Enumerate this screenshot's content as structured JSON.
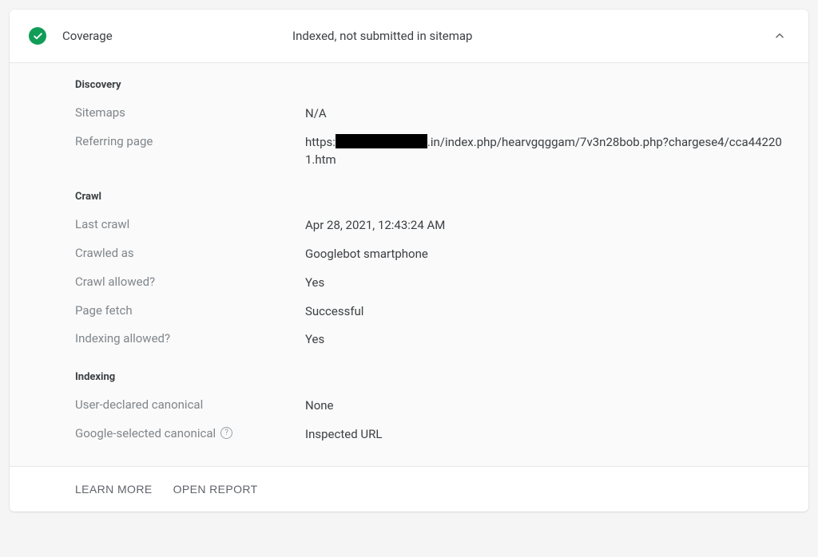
{
  "header": {
    "title": "Coverage",
    "status": "Indexed, not submitted in sitemap"
  },
  "sections": {
    "discovery": {
      "title": "Discovery",
      "sitemaps_label": "Sitemaps",
      "sitemaps_value": "N/A",
      "referring_label": "Referring page",
      "referring_prefix": "https:",
      "referring_suffix": ".in/index.php/hearvgqggam/7v3n28bob.php?chargese4/cca442201.htm"
    },
    "crawl": {
      "title": "Crawl",
      "last_crawl_label": "Last crawl",
      "last_crawl_value": "Apr 28, 2021, 12:43:24 AM",
      "crawled_as_label": "Crawled as",
      "crawled_as_value": "Googlebot smartphone",
      "crawl_allowed_label": "Crawl allowed?",
      "crawl_allowed_value": "Yes",
      "page_fetch_label": "Page fetch",
      "page_fetch_value": "Successful",
      "indexing_allowed_label": "Indexing allowed?",
      "indexing_allowed_value": "Yes"
    },
    "indexing": {
      "title": "Indexing",
      "user_canonical_label": "User-declared canonical",
      "user_canonical_value": "None",
      "google_canonical_label": "Google-selected canonical",
      "google_canonical_value": "Inspected URL"
    }
  },
  "footer": {
    "learn_more": "LEARN MORE",
    "open_report": "OPEN REPORT"
  }
}
